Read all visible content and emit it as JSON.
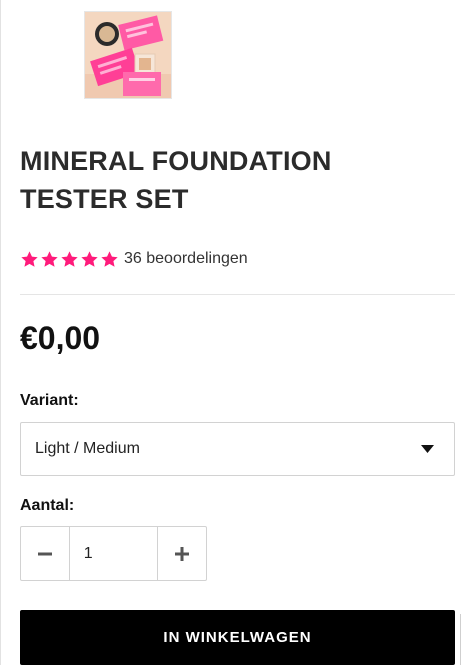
{
  "product": {
    "image_alt": "Mineral Foundation Tester Set",
    "title": "MINERAL FOUNDATION TESTER SET",
    "rating": {
      "stars": 5,
      "max_stars": 5,
      "count_label": "36 beoordelingen"
    },
    "price": "€0,00"
  },
  "variant": {
    "label": "Variant:",
    "selected": "Light / Medium"
  },
  "quantity": {
    "label": "Aantal:",
    "value": "1"
  },
  "cart": {
    "button_label": "IN WINKELWAGEN"
  },
  "colors": {
    "star": "#ff1b7b",
    "button_bg": "#000000"
  },
  "icons": {
    "star": "star-icon",
    "caret": "chevron-down-icon",
    "minus": "minus-icon",
    "plus": "plus-icon"
  }
}
